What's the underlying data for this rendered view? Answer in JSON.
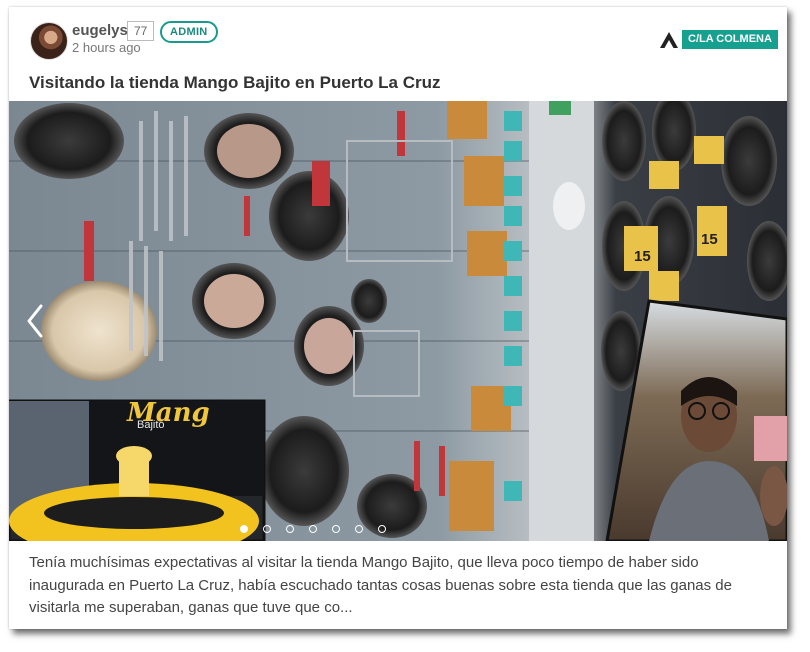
{
  "post": {
    "username": "eugelys",
    "reputation": "77",
    "role_badge": "ADMIN",
    "timestamp": "2 hours ago",
    "community": "C/LA COLMENA",
    "title": "Visitando la tienda Mango Bajito en Puerto La Cruz",
    "excerpt": "Tenía muchísimas expectativas al visitar la tienda Mango Bajito, que lleva poco tiempo de haber sido inaugurada en Puerto La Cruz, había escuchado tantas cosas buenas sobre esta tienda que las ganas de visitarla me superaban, ganas que tuve que co..."
  },
  "carousel": {
    "total_slides": 7,
    "active_index": 0,
    "prev_icon": "chevron-left-icon",
    "photo_signs": {
      "store_sign": "Mang",
      "store_sign_sub": "Bajito",
      "price_tag_1": "15",
      "price_tag_2": "15"
    }
  },
  "colors": {
    "accent": "#16a08f",
    "admin_border": "#1a9a8e",
    "title": "#333333",
    "text": "#444444"
  }
}
